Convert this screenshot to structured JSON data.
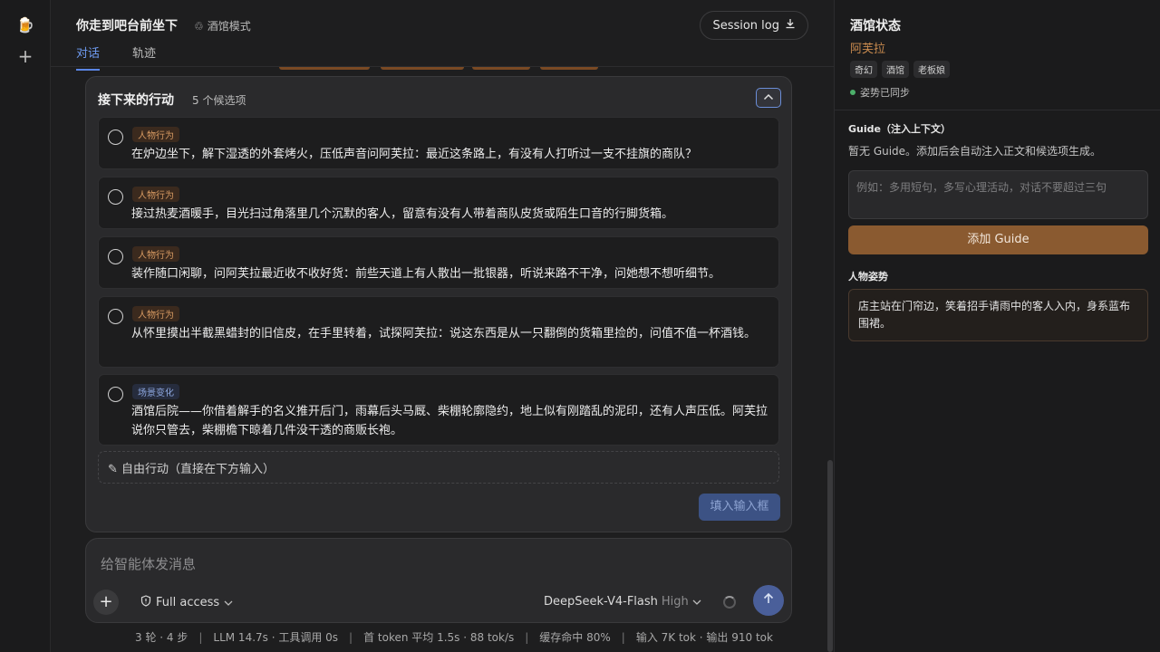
{
  "rail": {
    "logo_icon": "beer-mug-icon",
    "new_icon": "plus-icon"
  },
  "header": {
    "title": "你走到吧台前坐下",
    "mode": "酒馆模式",
    "session_log": "Session log",
    "tabs": [
      {
        "label": "对话",
        "active": true
      },
      {
        "label": "轨迹",
        "active": false
      }
    ]
  },
  "actions": {
    "title": "接下来的行动",
    "count": "5 个候选项",
    "options": [
      {
        "tag": "人物行为",
        "text": "在炉边坐下，解下湿透的外套烤火，压低声音问阿芙拉：最近这条路上，有没有人打听过一支不挂旗的商队？"
      },
      {
        "tag": "人物行为",
        "text": "接过热麦酒暖手，目光扫过角落里几个沉默的客人，留意有没有人带着商队皮货或陌生口音的行脚货箱。"
      },
      {
        "tag": "人物行为",
        "text": "装作随口闲聊，问阿芙拉最近收不收好货：前些天道上有人散出一批银器，听说来路不干净，问她想不想听细节。"
      },
      {
        "tag": "人物行为",
        "text": "从怀里摸出半截黑蜡封的旧信皮，在手里转着，试探阿芙拉：说这东西是从一只翻倒的货箱里捡的，问值不值一杯酒钱。"
      },
      {
        "tag": "场景变化",
        "text": "酒馆后院——你借着解手的名义推开后门，雨幕后头马厩、柴棚轮廓隐约，地上似有刚踏乱的泥印，还有人声压低。阿芙拉说你只管去，柴棚檐下晾着几件没干透的商贩长袍。"
      }
    ],
    "free_action": "✎ 自由行动（直接在下方输入）",
    "fill_button": "填入输入框"
  },
  "composer": {
    "placeholder": "给智能体发消息",
    "access": "Full access",
    "model": "DeepSeek-V4-Flash",
    "level": "High"
  },
  "stats": [
    "3 轮 · 4 步",
    "LLM 14.7s · 工具调用 0s",
    "首 token 平均 1.5s · 88 tok/s",
    "缓存命中 80%",
    "输入 7K tok · 输出 910 tok"
  ],
  "side": {
    "title": "酒馆状态",
    "name": "阿芙拉",
    "chips": [
      "奇幻",
      "酒馆",
      "老板娘"
    ],
    "synced": "姿势已同步",
    "guide_heading": "Guide（注入上下文）",
    "guide_empty": "暂无 Guide。添加后会自动注入正文和候选项生成。",
    "guide_placeholder": "例如：多用短句，多写心理活动，对话不要超过三句",
    "add_guide": "添加 Guide",
    "posture_heading": "人物姿势",
    "posture_text": "店主站在门帘边，笑着招手请雨中的客人入内，身系蓝布围裙。"
  },
  "colors": {
    "accent_blue": "#5b86e5",
    "accent_brown": "#8a5a30",
    "name_color": "#c88a4e"
  }
}
